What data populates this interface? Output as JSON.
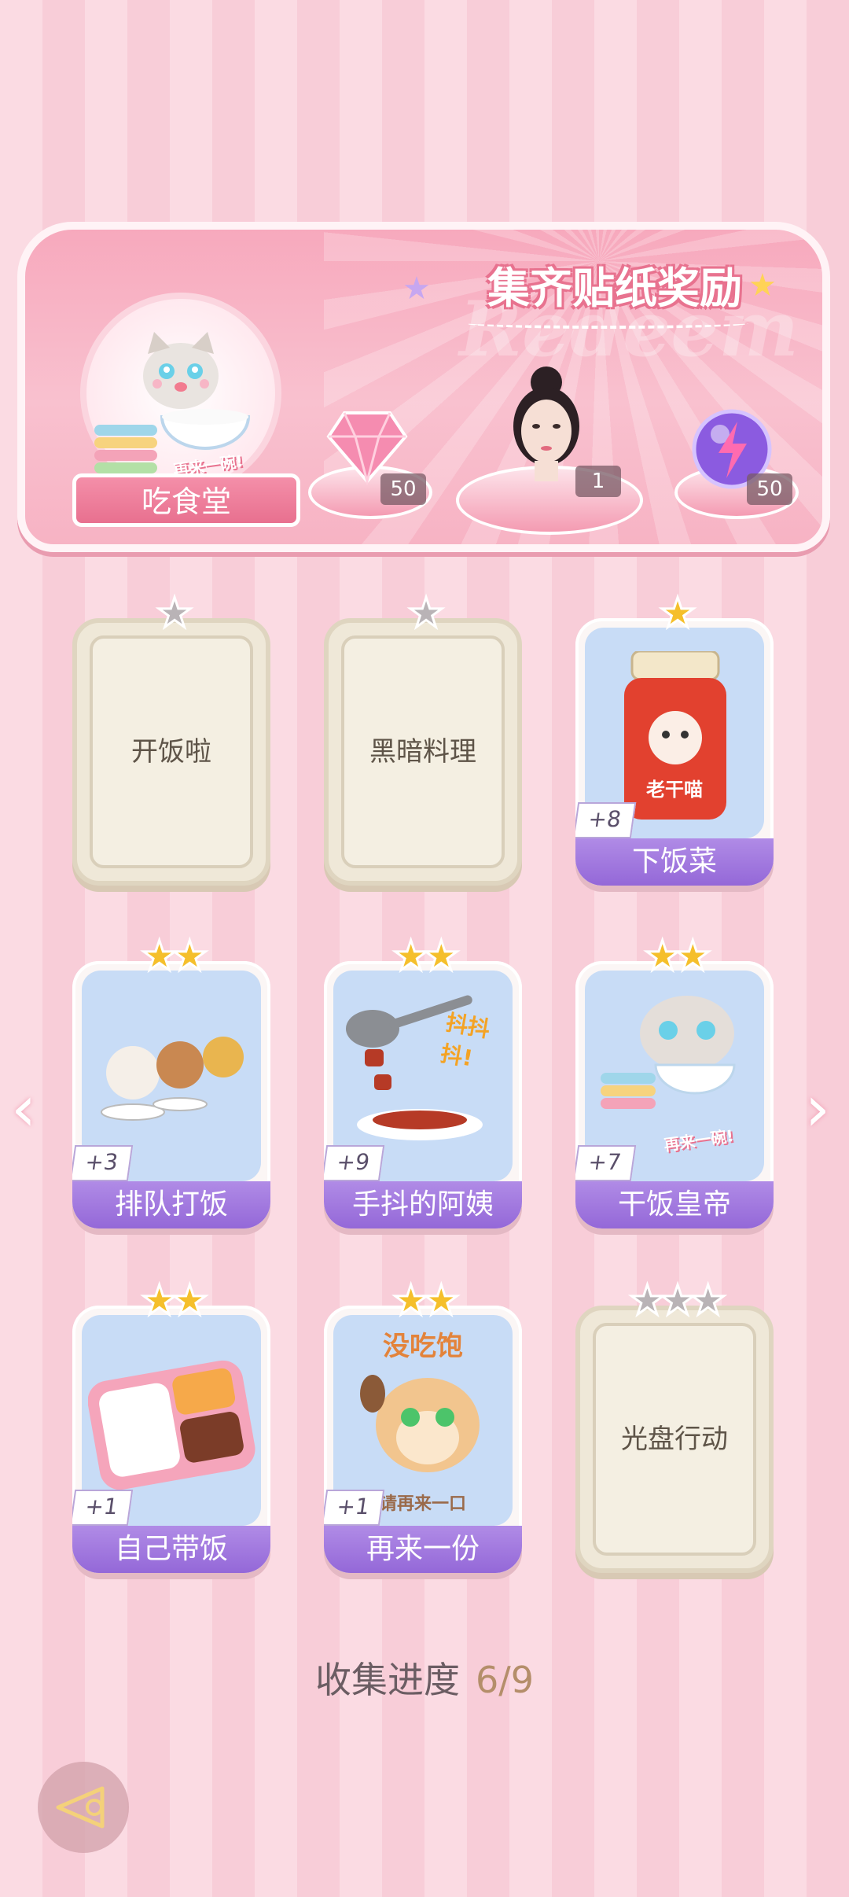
{
  "banner": {
    "title": "集齐贴纸奖励",
    "watermark": "Redeem",
    "badge_label": "吃食堂",
    "badge_art_text": "再来一碗!",
    "rewards": [
      {
        "name": "pink-diamond-icon",
        "count": "50"
      },
      {
        "name": "character-portrait",
        "count": "1"
      },
      {
        "name": "purple-energy-orb-icon",
        "count": "50"
      }
    ]
  },
  "cards": [
    {
      "title": "开饭啦",
      "locked": true,
      "stars": 1,
      "star_color": "gray",
      "bonus": ""
    },
    {
      "title": "黑暗料理",
      "locked": true,
      "stars": 1,
      "star_color": "gray",
      "bonus": ""
    },
    {
      "title": "下饭菜",
      "locked": false,
      "stars": 1,
      "star_color": "gold",
      "bonus": "+8",
      "art_text": "老干喵"
    },
    {
      "title": "排队打饭",
      "locked": false,
      "stars": 2,
      "star_color": "gold",
      "bonus": "+3"
    },
    {
      "title": "手抖的阿姨",
      "locked": false,
      "stars": 2,
      "star_color": "gold",
      "bonus": "+9",
      "art_text": "抖抖抖!"
    },
    {
      "title": "干饭皇帝",
      "locked": false,
      "stars": 2,
      "star_color": "gold",
      "bonus": "+7",
      "art_text": "再来一碗!"
    },
    {
      "title": "自己带饭",
      "locked": false,
      "stars": 2,
      "star_color": "gold",
      "bonus": "+1"
    },
    {
      "title": "再来一份",
      "locked": false,
      "stars": 2,
      "star_color": "gold",
      "bonus": "+1",
      "art_text_top": "没吃饱",
      "art_text_bottom": "请再来一口"
    },
    {
      "title": "光盘行动",
      "locked": true,
      "stars": 3,
      "star_color": "gray",
      "bonus": ""
    }
  ],
  "progress": {
    "label": "收集进度",
    "value": "6/9"
  },
  "nav": {
    "prev": "‹",
    "next": "›"
  },
  "colors": {
    "accent_pink": "#f48fa9",
    "label_purple": "#9468d8",
    "star_gold": "#f5bf2b"
  }
}
